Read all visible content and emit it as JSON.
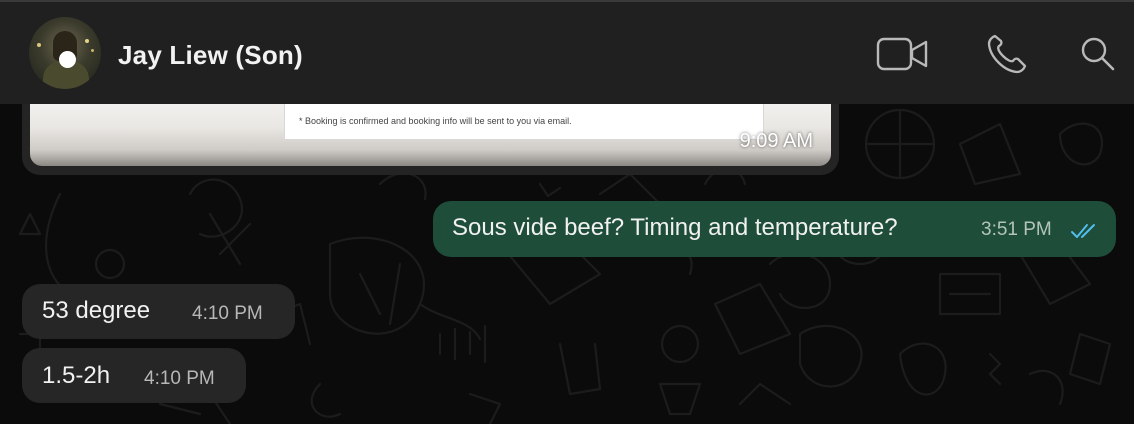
{
  "header": {
    "contact_name": "Jay Liew (Son)",
    "avatar_icon": "contact-avatar",
    "actions": [
      {
        "name": "video-call",
        "icon": "video-camera-icon"
      },
      {
        "name": "voice-call",
        "icon": "phone-icon"
      },
      {
        "name": "search",
        "icon": "search-icon"
      }
    ]
  },
  "messages": [
    {
      "direction": "incoming",
      "type": "image",
      "image_text": "* Booking is confirmed and booking info will be sent to you via email.",
      "time": "9:09 AM"
    },
    {
      "direction": "outgoing",
      "type": "text",
      "text": "Sous vide beef? Timing and temperature?",
      "time": "3:51 PM",
      "status": "read",
      "status_icon": "double-check-icon"
    },
    {
      "direction": "incoming",
      "type": "text",
      "text": "53 degree",
      "time": "4:10 PM"
    },
    {
      "direction": "incoming",
      "type": "text",
      "text": "1.5-2h",
      "time": "4:10 PM"
    }
  ],
  "colors": {
    "header_bg": "#202020",
    "outgoing_bubble": "#1e4d3a",
    "incoming_bubble": "#262626",
    "read_ticks": "#53bdeb"
  }
}
